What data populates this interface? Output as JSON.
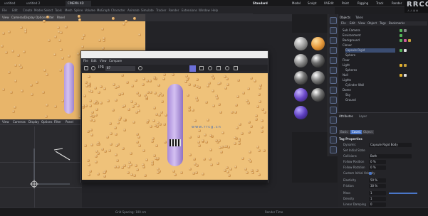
{
  "browser_tabs": [
    {
      "label": "untitled",
      "active": false
    },
    {
      "label": "untitled 2",
      "active": false
    },
    {
      "label": "CINEMA 4D",
      "active": true
    }
  ],
  "top_tools": [
    "Standard",
    "Model",
    "Sculpt",
    "UVEdit",
    "Paint",
    "Rigging",
    "Track",
    "Render"
  ],
  "menus": [
    "File",
    "Edit",
    "Create",
    "Modes",
    "Select",
    "Tools",
    "Mesh",
    "Spline",
    "Volume",
    "MoGraph",
    "Character",
    "Animate",
    "Simulate",
    "Tracker",
    "Render",
    "Extensions",
    "Window",
    "Help"
  ],
  "logo": {
    "title": "RRCG",
    "subtitle": "人人素材"
  },
  "left_viewport": {
    "menu": [
      "View",
      "Cameras",
      "Display",
      "Options",
      "Filter",
      "Panel"
    ]
  },
  "perspective_viewport": {
    "menu": [
      "View",
      "Cameras",
      "Display",
      "Options",
      "Filter",
      "Panel"
    ]
  },
  "render_window": {
    "menu": [
      "File",
      "Edit",
      "View",
      "Compare"
    ],
    "frame_label": "IPR",
    "zoom": "87",
    "watermark": "www.rrcg.cn"
  },
  "object_manager": {
    "tabs": [
      "Objects",
      "Takes"
    ],
    "menu": [
      "File",
      "Edit",
      "View",
      "Object",
      "Tags",
      "Bookmarks"
    ],
    "rows": [
      "Sub Camera",
      "Environment",
      "Background",
      "Cloner",
      "Capsule Rigid",
      "Sphere",
      "Floor",
      "Light",
      "Spheres",
      "Null",
      "Lights",
      "Cylinder Wall",
      "Dome",
      "Sky",
      "Ground"
    ]
  },
  "attributes": {
    "tabs": [
      "Attributes",
      "Layer"
    ],
    "subtabs": [
      "Basic",
      "Coord.",
      "Object",
      "Phong"
    ],
    "section": "Tag Properties",
    "rows": [
      {
        "label": "Dynamic",
        "value": "Capsule Rigid Body"
      },
      {
        "label": "Set Initial State",
        "value": ""
      },
      {
        "label": "Collisions",
        "value": "Both"
      },
      {
        "label": "Follow Position",
        "value": "0 %"
      },
      {
        "label": "Follow Rotation",
        "value": "0 %"
      },
      {
        "label": "Custom Initial Velocity",
        "value": ""
      },
      {
        "label": "Elasticity",
        "value": "50 %"
      },
      {
        "label": "Friction",
        "value": "30 %"
      },
      {
        "label": "Mass",
        "value": "1"
      },
      {
        "label": "Density",
        "value": "1"
      },
      {
        "label": "Linear Damping",
        "value": "0"
      },
      {
        "label": "Angular Damping",
        "value": "0"
      }
    ]
  },
  "bottom_status": {
    "left": "Grid Spacing: 100 cm",
    "right": "Render Time"
  },
  "colors": {
    "floor": "#efc27a",
    "capsule": "#c9b2ec",
    "sphere": "#c8893e",
    "selection": "#3b4d72",
    "accent": "#4a76c8"
  }
}
